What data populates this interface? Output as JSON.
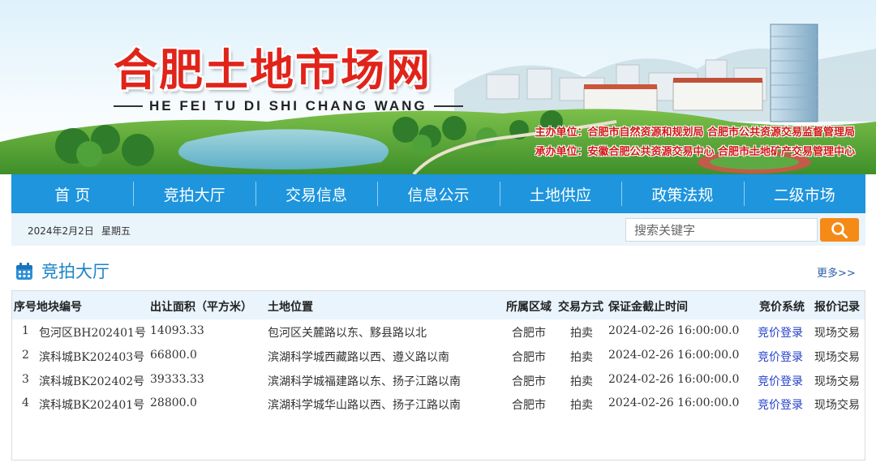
{
  "brand": {
    "title": "合肥土地市场网",
    "subtitle": "HE FEI TU DI SHI CHANG WANG",
    "sponsor_line1": "主办单位：合肥市自然资源和规划局  合肥市公共资源交易监督管理局",
    "sponsor_line2": "承办单位：安徽合肥公共资源交易中心  合肥市土地矿产交易管理中心"
  },
  "nav": {
    "items": [
      "首 页",
      "竞拍大厅",
      "交易信息",
      "信息公示",
      "土地供应",
      "政策法规",
      "二级市场"
    ]
  },
  "infobar": {
    "date": "2024年2月2日",
    "weekday": "星期五",
    "search_placeholder": "搜索关键字",
    "search_icon": "magnifier-icon"
  },
  "section": {
    "title": "竞拍大厅",
    "more": "更多>>",
    "icon": "calendar-icon"
  },
  "table": {
    "headers": {
      "seq_code": "序号地块编号",
      "area": "出让面积（平方米）",
      "location": "土地位置",
      "district": "所属区域",
      "method": "交易方式",
      "deadline": "保证金截止时间",
      "system": "竞价系统",
      "record": "报价记录"
    },
    "rows": [
      {
        "seq": "1",
        "code": "包河区BH202401号",
        "area": "14093.33",
        "location": "包河区关麓路以东、黟县路以北",
        "district": "合肥市",
        "method": "拍卖",
        "deadline": "2024-02-26 16:00:00.0",
        "system": "竞价登录",
        "record": "现场交易"
      },
      {
        "seq": "2",
        "code": "滨科城BK202403号",
        "area": "66800.0",
        "location": "滨湖科学城西藏路以西、遵义路以南",
        "district": "合肥市",
        "method": "拍卖",
        "deadline": "2024-02-26 16:00:00.0",
        "system": "竞价登录",
        "record": "现场交易"
      },
      {
        "seq": "3",
        "code": "滨科城BK202402号",
        "area": "39333.33",
        "location": "滨湖科学城福建路以东、扬子江路以南",
        "district": "合肥市",
        "method": "拍卖",
        "deadline": "2024-02-26 16:00:00.0",
        "system": "竞价登录",
        "record": "现场交易"
      },
      {
        "seq": "4",
        "code": "滨科城BK202401号",
        "area": "28800.0",
        "location": "滨湖科学城华山路以西、扬子江路以南",
        "district": "合肥市",
        "method": "拍卖",
        "deadline": "2024-02-26 16:00:00.0",
        "system": "竞价登录",
        "record": "现场交易"
      }
    ]
  },
  "colors": {
    "nav_bg": "#1e95dd",
    "title_red": "#e0241b",
    "search_orange": "#f58a16",
    "link_blue": "#2440c8"
  }
}
